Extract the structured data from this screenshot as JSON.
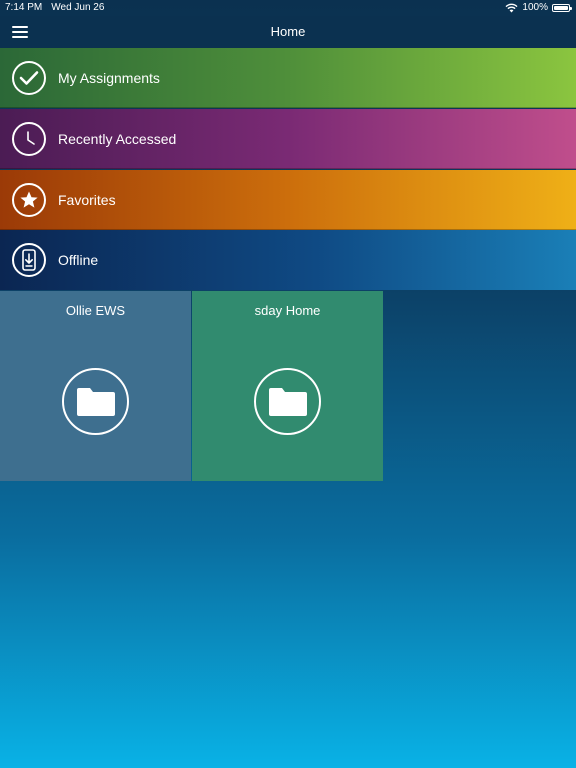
{
  "status_bar": {
    "time": "7:14 PM",
    "date": "Wed Jun 26",
    "battery_percent": "100%"
  },
  "nav": {
    "title": "Home",
    "menu_icon": "hamburger-menu-icon"
  },
  "menu_rows": [
    {
      "label": "My Assignments",
      "icon": "checkmark-icon"
    },
    {
      "label": "Recently Accessed",
      "icon": "clock-icon"
    },
    {
      "label": "Favorites",
      "icon": "star-icon"
    },
    {
      "label": "Offline",
      "icon": "device-download-icon"
    }
  ],
  "folders": [
    {
      "label": "Ollie EWS",
      "icon": "folder-icon",
      "color": "#3e6f8f"
    },
    {
      "label": "sday Home",
      "icon": "folder-icon",
      "color": "#318b6f"
    }
  ]
}
